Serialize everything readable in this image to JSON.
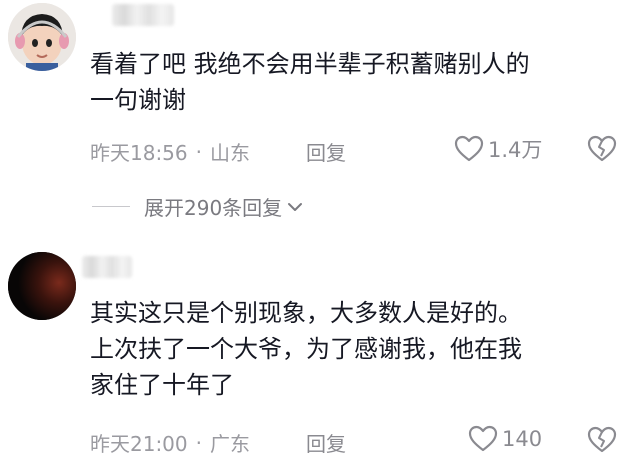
{
  "comments": [
    {
      "text_lines": [
        "看着了吧 我绝不会用半辈子积蓄赌别人的",
        "一句谢谢"
      ],
      "time": "昨天18:56",
      "location": "山东",
      "reply_label": "回复",
      "likes": "1.4万",
      "expand_label": "展开290条回复"
    },
    {
      "text_lines": [
        "其实这只是个别现象，大多数人是好的。",
        "上次扶了一个大爷，为了感谢我，他在我",
        "家住了十年了"
      ],
      "time": "昨天21:00",
      "location": "广东",
      "reply_label": "回复",
      "likes": "140"
    }
  ],
  "separator": "·",
  "icons": {
    "like": "heart-outline-icon",
    "dislike": "broken-heart-icon",
    "expand": "chevron-down-icon"
  },
  "colors": {
    "text": "#161823",
    "meta": "#9a9aa0"
  }
}
